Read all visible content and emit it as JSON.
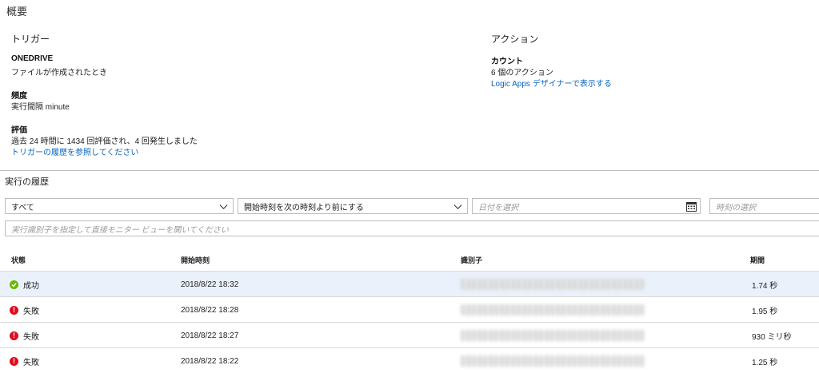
{
  "overview": {
    "title": "概要",
    "trigger_heading": "トリガー",
    "action_heading": "アクション",
    "trigger_name": "ONEDRIVE",
    "trigger_desc": "ファイルが作成されたとき",
    "frequency_label": "頻度",
    "frequency_value": "実行間隔 minute",
    "evaluation_label": "評価",
    "evaluation_value": "過去 24 時間に 1434 回評価され、4 回発生しました",
    "trigger_history_link": "トリガーの履歴を参照してください",
    "count_label": "カウント",
    "count_value": "6 個のアクション",
    "designer_link": "Logic Apps デザイナーで表示する"
  },
  "history": {
    "title": "実行の履歴",
    "status_filter": "すべて",
    "time_filter": "開始時刻を次の時刻より前にする",
    "date_placeholder": "日付を選択",
    "time_placeholder": "時刻の選択",
    "run_id_placeholder": "実行識別子を指定して直接モニター ビューを開いてください",
    "columns": [
      "状態",
      "開始時刻",
      "識別子",
      "期間"
    ],
    "rows": [
      {
        "status": "成功",
        "status_type": "success",
        "start": "2018/8/22 18:32",
        "duration": "1.74 秒"
      },
      {
        "status": "失敗",
        "status_type": "failed",
        "start": "2018/8/22 18:28",
        "duration": "1.95 秒"
      },
      {
        "status": "失敗",
        "status_type": "failed",
        "start": "2018/8/22 18:27",
        "duration": "930 ミリ秒"
      },
      {
        "status": "失敗",
        "status_type": "failed",
        "start": "2018/8/22 18:22",
        "duration": "1.25 秒"
      }
    ]
  },
  "colors": {
    "success": "#6bb700",
    "failed": "#e00b1c",
    "link": "#0a63c1",
    "selected_row": "#eaf1fb"
  }
}
